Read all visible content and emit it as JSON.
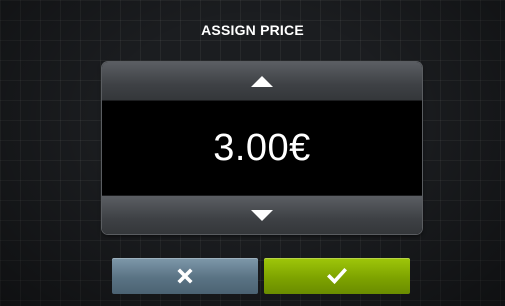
{
  "dialog": {
    "title": "ASSIGN PRICE",
    "price_value": "3.00€"
  },
  "icons": {
    "increase": "triangle-up-icon",
    "decrease": "triangle-down-icon",
    "cancel": "x-icon",
    "confirm": "checkmark-icon"
  },
  "colors": {
    "cancel_button": "#5a7384",
    "confirm_button": "#7ea300",
    "display_background": "#000000",
    "text": "#ffffff"
  }
}
